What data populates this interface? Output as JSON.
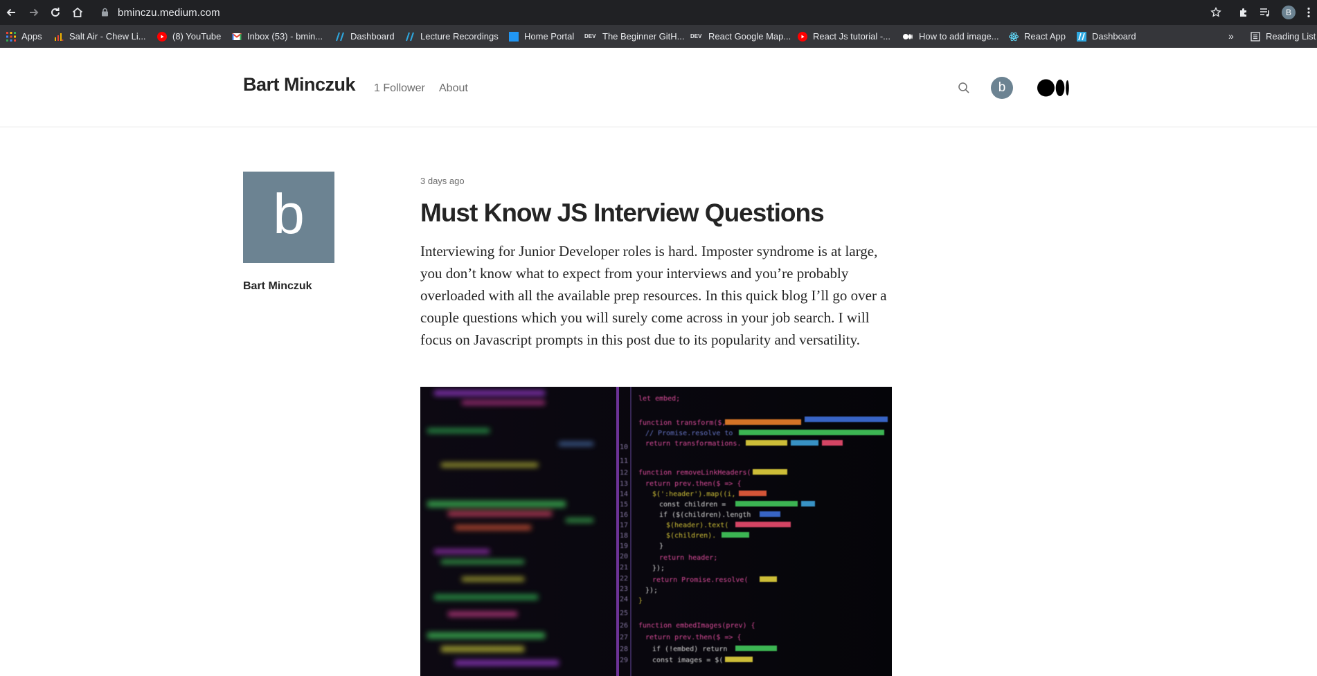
{
  "browser": {
    "url": "bminczu.medium.com",
    "profile_initial": "B",
    "bookmarks": [
      {
        "label": "Apps",
        "icon": "apps-grid-icon",
        "color": "#ea4335"
      },
      {
        "label": "Salt Air - Chew Li...",
        "icon": "salt-air-icon",
        "color": "#f4b400"
      },
      {
        "label": "(8) YouTube",
        "icon": "youtube-icon",
        "color": "#ff0000"
      },
      {
        "label": "Inbox (53) - bmin...",
        "icon": "gmail-icon",
        "color": "#ea4335"
      },
      {
        "label": "Dashboard",
        "icon": "slash-icon",
        "color": "#2ea8e0"
      },
      {
        "label": "Lecture Recordings",
        "icon": "slash-icon",
        "color": "#2ea8e0"
      },
      {
        "label": "Home Portal",
        "icon": "portal-icon",
        "color": "#2196f3"
      },
      {
        "label": "The Beginner GitH...",
        "icon": "dev-icon",
        "color": "#e8eaed"
      },
      {
        "label": "React Google Map...",
        "icon": "dev-icon",
        "color": "#e8eaed"
      },
      {
        "label": "React Js tutorial -...",
        "icon": "youtube-icon",
        "color": "#ff0000"
      },
      {
        "label": "How to add image...",
        "icon": "medium-icon",
        "color": "#ffffff"
      },
      {
        "label": "React App",
        "icon": "react-icon",
        "color": "#61dafb"
      },
      {
        "label": "Dashboard",
        "icon": "slash-icon",
        "color": "#2ea8e0"
      }
    ],
    "more_bookmarks": "»",
    "reading_list": "Reading List"
  },
  "header": {
    "author_name": "Bart Minczuk",
    "followers": "1 Follower",
    "about": "About",
    "avatar_initial": "b"
  },
  "author_card": {
    "avatar_initial": "b",
    "name": "Bart Minczuk"
  },
  "post": {
    "date": "3 days ago",
    "title": "Must Know JS Interview Questions",
    "excerpt": "Interviewing for Junior Developer roles is hard. Imposter syndrome is at large, you don’t know what to expect from your interviews and you’re probably overloaded with all the available prep resources. In this quick blog I’ll go over a couple questions which you will surely come across in your job search. I will focus on Javascript prompts in this post due to its popularity and versatility."
  },
  "colors": {
    "avatar_bg": "#6c8392",
    "chrome_dark": "#202124",
    "bookmark_bar": "#35363a"
  }
}
